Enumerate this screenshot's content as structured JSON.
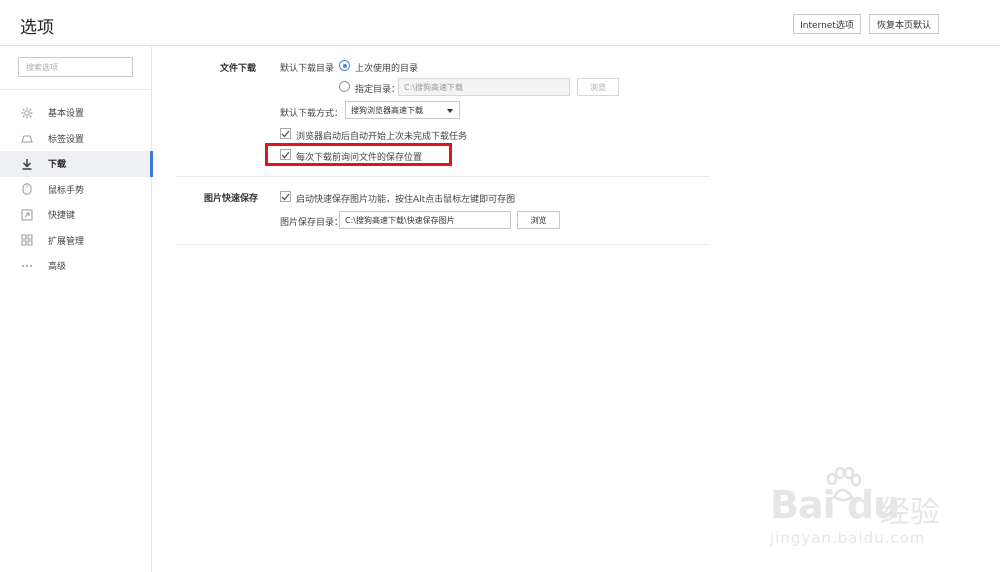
{
  "header": {
    "title": "选项",
    "buttons": {
      "internet": "Internet选项",
      "restore": "恢复本页默认"
    }
  },
  "sidebar": {
    "search_placeholder": "搜索选项",
    "items": [
      {
        "label": "基本设置",
        "icon": "gear-icon",
        "active": false
      },
      {
        "label": "标签设置",
        "icon": "tab-icon",
        "active": false
      },
      {
        "label": "下载",
        "icon": "download-icon",
        "active": true
      },
      {
        "label": "鼠标手势",
        "icon": "mouse-icon",
        "active": false
      },
      {
        "label": "快捷键",
        "icon": "shortcut-icon",
        "active": false
      },
      {
        "label": "扩展管理",
        "icon": "extensions-icon",
        "active": false
      },
      {
        "label": "高级",
        "icon": "more-icon",
        "active": false
      }
    ],
    "accent_color": "#3a7bd5"
  },
  "download": {
    "title": "文件下载",
    "default_dir_label": "默认下载目录",
    "radio_last": "上次使用的目录",
    "radio_specify": "指定目录：",
    "specify_path": "C:\\搜狗高速下载",
    "browse_label": "浏览",
    "method_label": "默认下载方式：",
    "method_value": "搜狗浏览器高速下载",
    "resume_label": "浏览器启动后自动开始上次未完成下载任务",
    "ask_label": "每次下载前询问文件的保存位置"
  },
  "image_save": {
    "title": "图片快速保存",
    "enable_label": "启动快速保存图片功能，按住Alt点击鼠标左键即可存图",
    "dir_label": "图片保存目录：",
    "dir_value": "C:\\搜狗高速下载\\快速保存图片",
    "browse_label": "浏览"
  },
  "watermark": {
    "logo": "Bai du",
    "cn": "经验",
    "url": "jingyan.baidu.com"
  },
  "highlight_color": "#e0141e"
}
